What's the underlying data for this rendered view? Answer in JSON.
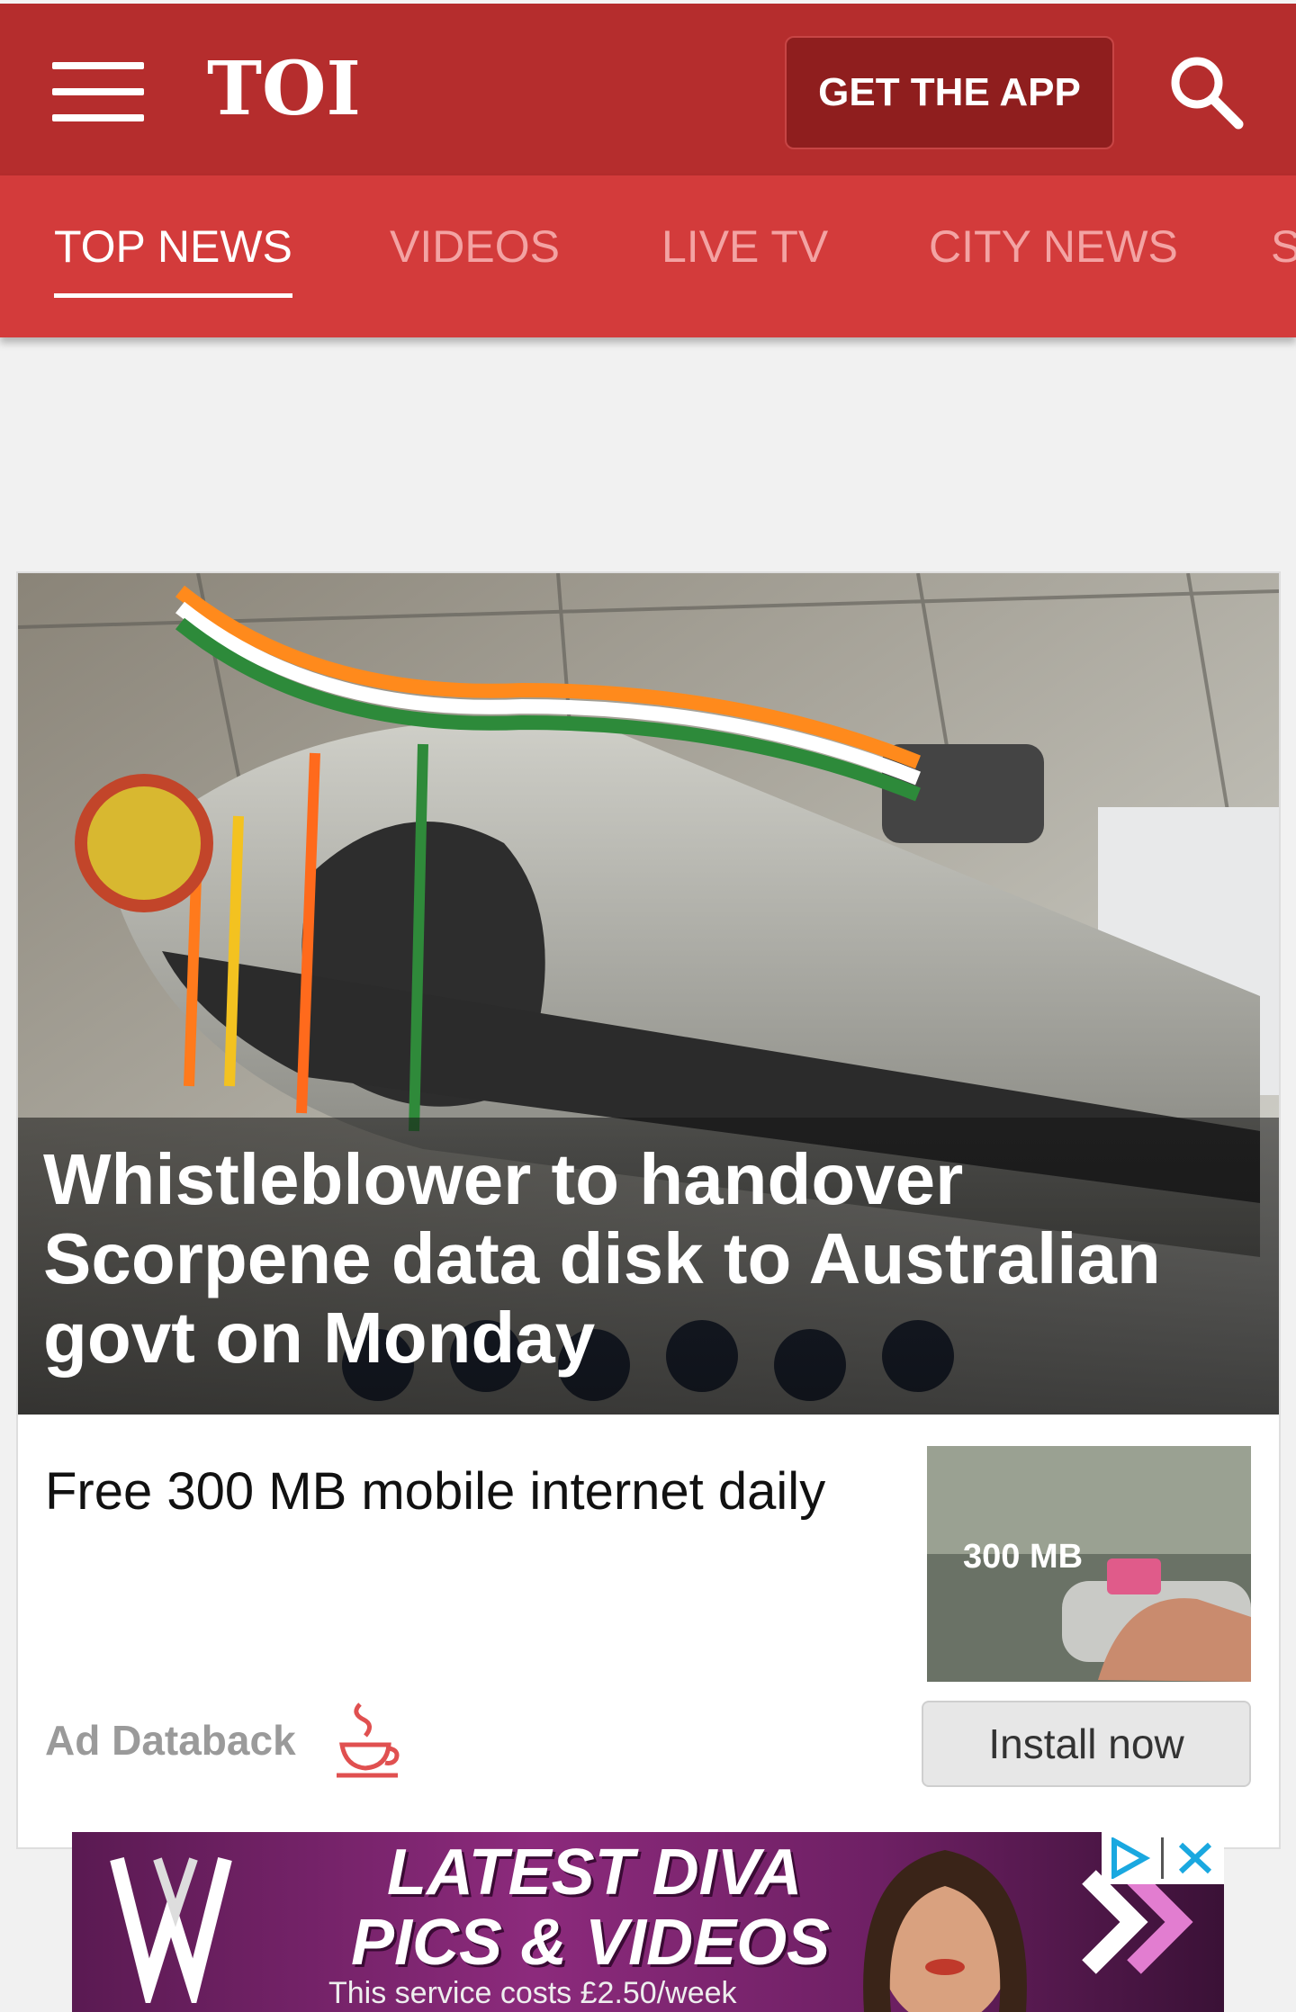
{
  "header": {
    "logo": "TOI",
    "get_app_label": "GET THE APP",
    "colors": {
      "header_bg": "#b52d2d",
      "tabs_bg": "#d33b3b",
      "accent": "#ffffff"
    }
  },
  "tabs": [
    {
      "label": "TOP NEWS",
      "active": true
    },
    {
      "label": "VIDEOS",
      "active": false
    },
    {
      "label": "LIVE TV",
      "active": false
    },
    {
      "label": "CITY NEWS",
      "active": false
    }
  ],
  "hero": {
    "headline": "Whistleblower to handover Scorpene data disk to Australian govt on Monday",
    "image": "submarine-launch-photo"
  },
  "sponsored": {
    "headline": "Free 300 MB mobile internet daily",
    "source": "Ad Databack",
    "cta": "Install now",
    "thumb_text": "300 MB"
  },
  "banner": {
    "line1": "LATEST DIVA",
    "line2": "PICS & VIDEOS",
    "note": "This service costs £2.50/week"
  }
}
